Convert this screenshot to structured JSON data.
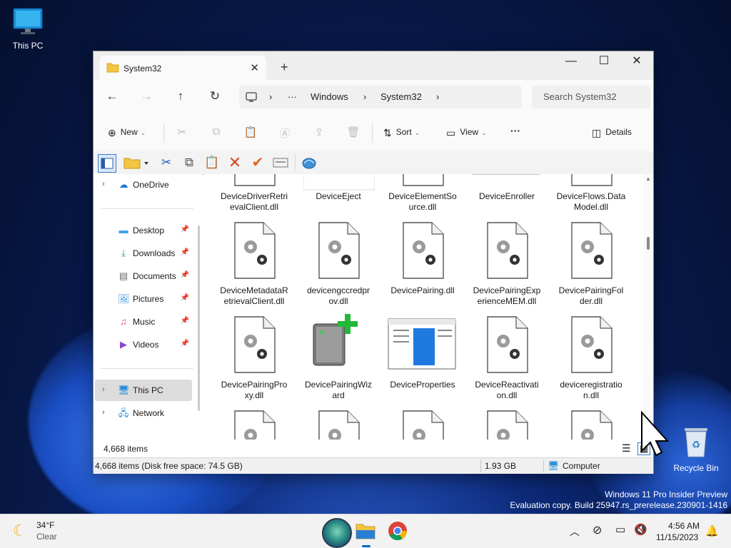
{
  "desktop": {
    "this_pc_label": "This PC",
    "recycle_bin_label": "Recycle Bin",
    "watermark_line1": "Windows 11 Pro Insider Preview",
    "watermark_line2": "Evaluation copy. Build 25947.rs_prerelease.230901-1416"
  },
  "window": {
    "tab_title": "System32",
    "new_tab": "+",
    "close_tab": "✕",
    "minimize": "—",
    "maximize": "☐",
    "close": "✕"
  },
  "address": {
    "crumb_ellipsis": "···",
    "crumb_1": "Windows",
    "crumb_2": "System32",
    "search_placeholder": "Search System32"
  },
  "commands": {
    "new_label": "New",
    "sort_label": "Sort",
    "view_label": "View",
    "more_label": "···",
    "details_label": "Details"
  },
  "sidebar": {
    "onedrive": "OneDrive",
    "desktop": "Desktop",
    "downloads": "Downloads",
    "documents": "Documents",
    "pictures": "Pictures",
    "music": "Music",
    "videos": "Videos",
    "this_pc": "This PC",
    "network": "Network"
  },
  "files": {
    "row0": [
      "DeviceDriverRetrievalClient.dll",
      "DeviceEject",
      "DeviceElementSource.dll",
      "DeviceEnroller",
      "DeviceFlows.DataModel.dll"
    ],
    "row0_lines": [
      [
        "DeviceDriverRetri",
        "evalClient.dll"
      ],
      [
        "DeviceEject",
        ""
      ],
      [
        "DeviceElementSo",
        "urce.dll"
      ],
      [
        "DeviceEnroller",
        ""
      ],
      [
        "DeviceFlows.Data",
        "Model.dll"
      ]
    ],
    "row1_lines": [
      [
        "DeviceMetadataR",
        "etrievalClient.dll"
      ],
      [
        "devicengccredpr",
        "ov.dll"
      ],
      [
        "DevicePairing.dll",
        ""
      ],
      [
        "DevicePairingExp",
        "erienceMEM.dll"
      ],
      [
        "DevicePairingFol",
        "der.dll"
      ]
    ],
    "row2_lines": [
      [
        "DevicePairingPro",
        "xy.dll"
      ],
      [
        "DevicePairingWiz",
        "ard"
      ],
      [
        "DeviceProperties",
        ""
      ],
      [
        "DeviceReactivati",
        "on.dll"
      ],
      [
        "deviceregistratio",
        "n.dll"
      ]
    ]
  },
  "status": {
    "item_count": "4,668 items",
    "disk_info": "4,668 items (Disk free space: 74.5 GB)",
    "size": "1.93 GB",
    "location": "Computer"
  },
  "taskbar": {
    "temperature": "34°F",
    "condition": "Clear",
    "time": "4:56 AM",
    "date": "11/15/2023"
  },
  "colors": {
    "accent": "#0067c0",
    "folder": "#f4c542"
  }
}
